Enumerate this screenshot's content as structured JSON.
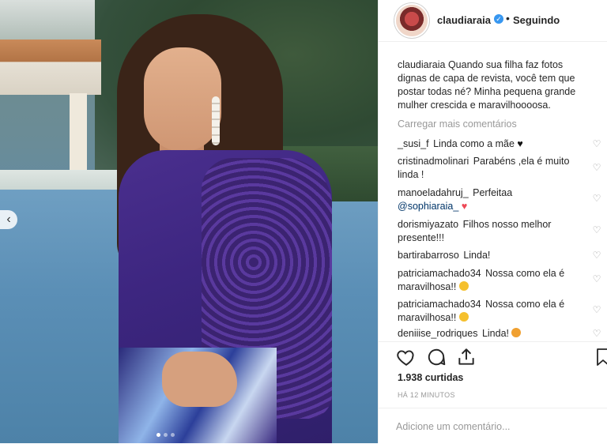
{
  "post": {
    "username": "claudiaraia",
    "follow_status": "Seguindo",
    "separator": "•",
    "caption_user": "claudiaraia",
    "caption_text": "Quando sua filha faz fotos dignas de capa de revista, você tem que postar todas né? Minha pequena grande mulher crescida e maravilhoooosa.",
    "load_more": "Carregar mais comentários",
    "likes": "1.938 curtidas",
    "time": "HÁ 12 MINUTOS",
    "comment_placeholder": "Adicione um comentário..."
  },
  "comments": [
    {
      "user": "_susi_f",
      "text": "Linda como a mãe",
      "emoji": "black-heart"
    },
    {
      "user": "cristinadmolinari",
      "text": "Parabéns ,ela é muito linda !"
    },
    {
      "user": "manoeladahruj_",
      "text": "Perfeitaa",
      "mention": "@sophiaraia_",
      "emoji": "red-heart"
    },
    {
      "user": "dorismiyazato",
      "text": "Filhos nosso melhor presente!!!"
    },
    {
      "user": "bartirabarroso",
      "text": "Linda!"
    },
    {
      "user": "patriciamachado34",
      "text": "Nossa como ela é maravilhosa!!",
      "emoji": "clap"
    },
    {
      "user": "patriciamachado34",
      "text": "Nossa como ela é maravilhosa!!",
      "emoji": "clap"
    },
    {
      "user": "deniiise_rodriques",
      "text": "Linda!",
      "emoji": "heart-eyes"
    }
  ],
  "icons": {
    "verified": "verified-badge-icon",
    "like": "heart-icon",
    "comment": "comment-icon",
    "share": "share-icon",
    "save": "bookmark-icon",
    "prev": "chevron-left-icon"
  },
  "colors": {
    "verified": "#3897f0",
    "muted": "#999999",
    "text": "#262626",
    "mention": "#003569",
    "heart": "#ed4956"
  }
}
